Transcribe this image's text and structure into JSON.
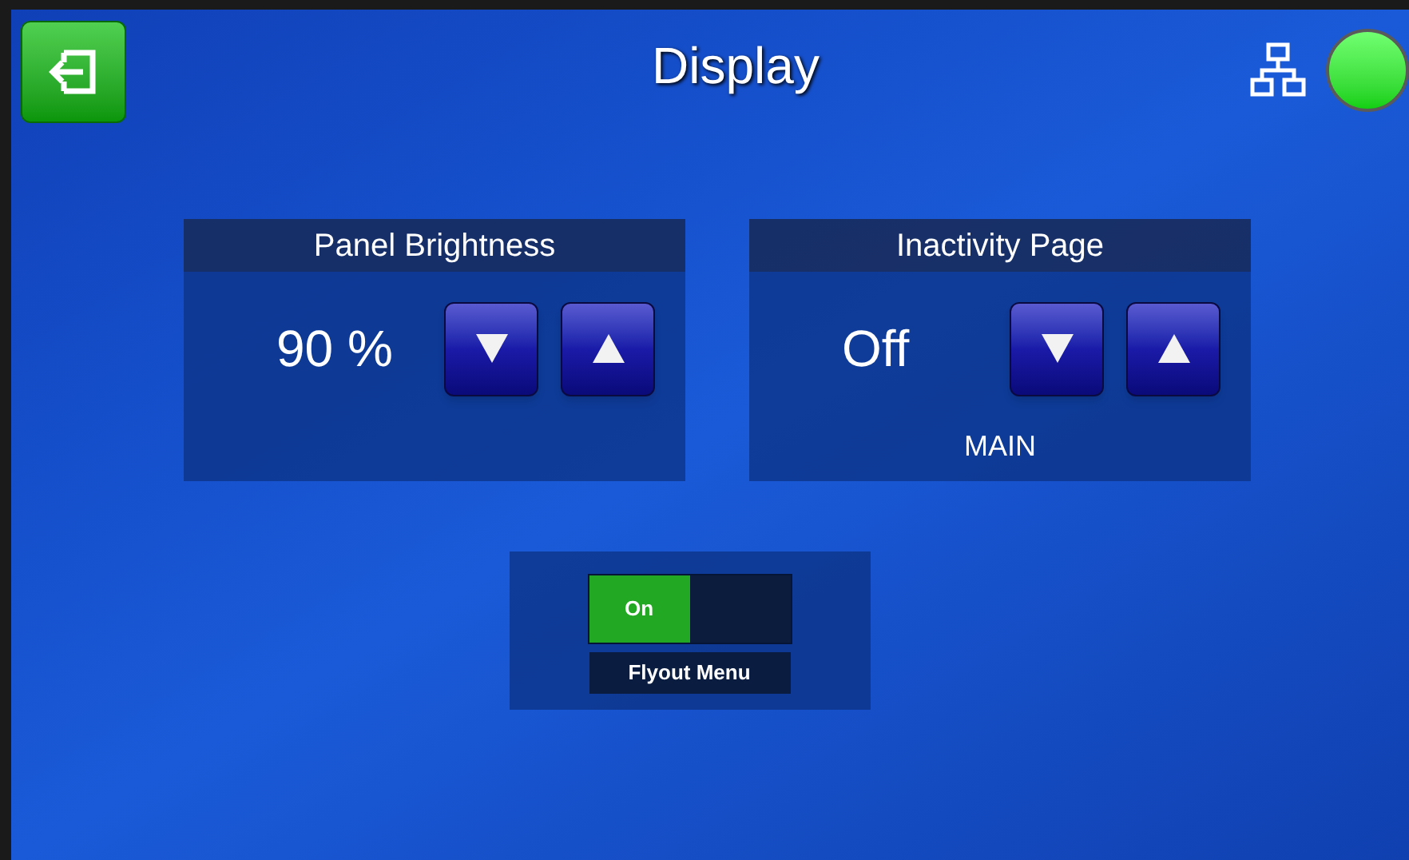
{
  "header": {
    "title": "Display",
    "status_on": true
  },
  "panels": [
    {
      "title": "Panel Brightness",
      "value": "90 %"
    },
    {
      "title": "Inactivity Page",
      "value": "Off",
      "caption": "MAIN"
    }
  ],
  "flyout": {
    "on": true,
    "on_label": "On",
    "label": "Flyout Menu"
  }
}
